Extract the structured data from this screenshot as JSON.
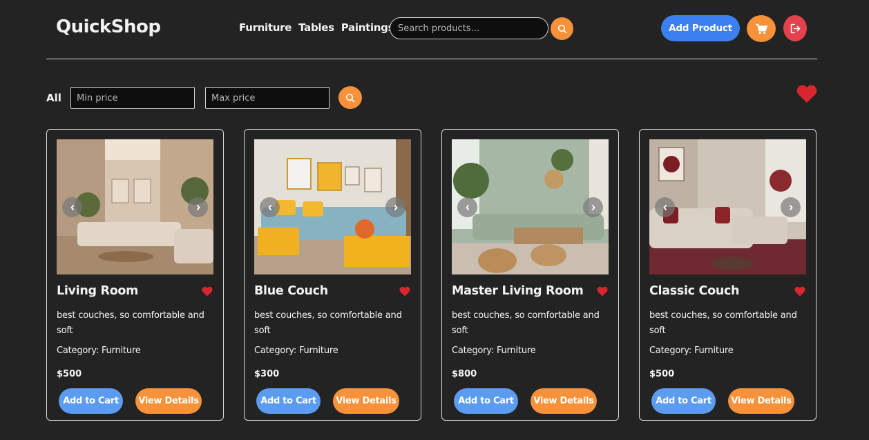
{
  "header": {
    "logo": "QuickShop",
    "nav": [
      "Furniture",
      "Tables",
      "Paintings"
    ],
    "search_placeholder": "Search products...",
    "add_product_label": "Add Product"
  },
  "filters": {
    "all_label": "All",
    "min_price_placeholder": "Min price",
    "max_price_placeholder": "Max price"
  },
  "colors": {
    "background": "#232323",
    "accent_orange": "#f7923a",
    "accent_blue": "#3b7ff0",
    "button_blue": "#5b9bf0",
    "logout_red": "#e5414c",
    "heart_red": "#d7262e"
  },
  "icons": {
    "search": "search-icon",
    "cart": "cart-icon",
    "logout": "logout-icon",
    "heart": "heart-icon",
    "chevron_left": "chevron-left-icon",
    "chevron_right": "chevron-right-icon"
  },
  "products": [
    {
      "title": "Living Room",
      "description": "best couches, so comfortable and soft",
      "category": "Category: Furniture",
      "price": "$500",
      "add_to_cart": "Add to Cart",
      "view_details": "View Details"
    },
    {
      "title": "Blue Couch",
      "description": "best couches, so comfortable and soft",
      "category": "Category: Furniture",
      "price": "$300",
      "add_to_cart": "Add to Cart",
      "view_details": "View Details"
    },
    {
      "title": "Master Living Room",
      "description": "best couches, so comfortable and soft",
      "category": "Category: Furniture",
      "price": "$800",
      "add_to_cart": "Add to Cart",
      "view_details": "View Details"
    },
    {
      "title": "Classic Couch",
      "description": "best couches, so comfortable and soft",
      "category": "Category: Furniture",
      "price": "$500",
      "add_to_cart": "Add to Cart",
      "view_details": "View Details"
    }
  ]
}
